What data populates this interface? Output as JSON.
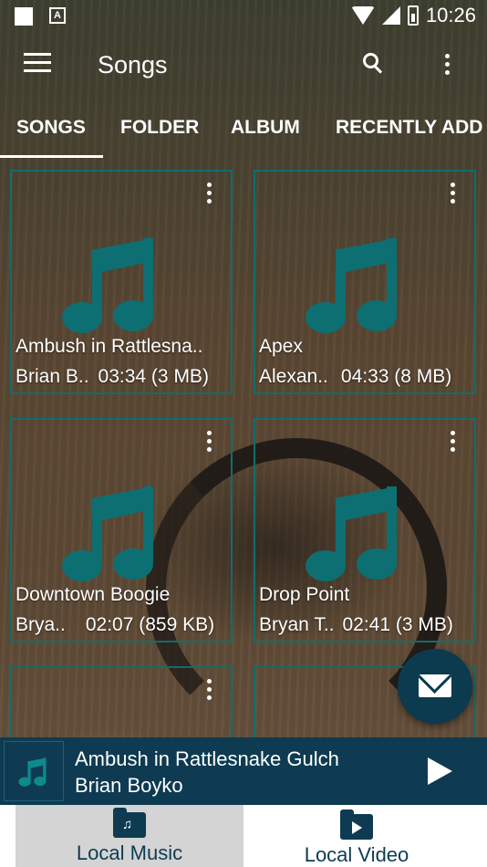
{
  "status_bar": {
    "time": "10:26",
    "notification_badge": "A"
  },
  "app_bar": {
    "title": "Songs"
  },
  "tabs": [
    {
      "label": "SONGS",
      "active": true
    },
    {
      "label": "FOLDER",
      "active": false
    },
    {
      "label": "ALBUM",
      "active": false
    },
    {
      "label": "RECENTLY ADD",
      "active": false
    }
  ],
  "songs": [
    {
      "title": "Ambush in Rattlesna..",
      "artist": "Brian B..",
      "meta": "03:34 (3 MB)"
    },
    {
      "title": "Apex",
      "artist": "Alexan..",
      "meta": "04:33 (8 MB)"
    },
    {
      "title": "Downtown Boogie",
      "artist": "Brya..",
      "meta": "02:07 (859 KB)"
    },
    {
      "title": "Drop Point",
      "artist": "Bryan T..",
      "meta": "02:41 (3 MB)"
    },
    {
      "title": "",
      "artist": "",
      "meta": ""
    },
    {
      "title": "",
      "artist": "",
      "meta": ""
    }
  ],
  "now_playing": {
    "title": "Ambush in Rattlesnake Gulch",
    "artist": "Brian Boyko"
  },
  "bottom_nav": [
    {
      "label": "Local Music",
      "icon": "music-folder-icon",
      "active": true
    },
    {
      "label": "Local Video",
      "icon": "video-folder-icon",
      "active": false
    }
  ],
  "colors": {
    "accent_teal": "#0f6e6c",
    "note_teal": "#0d6f72",
    "player_bg": "#0e3b52",
    "fab_bg": "#0c3a4f"
  }
}
